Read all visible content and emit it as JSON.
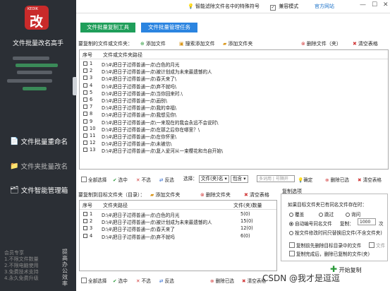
{
  "sidebar": {
    "logo_tag": "KEDIK",
    "logo_glyph": "改",
    "app_title": "文件批量改名高手",
    "nav": [
      {
        "label": "文件批量重命名"
      },
      {
        "label": "文件夹批量改名"
      },
      {
        "label": "文件智能管理箱"
      }
    ],
    "promo_lines": [
      "会员专享",
      "1.不限文件数量",
      "2.不限电脑使用",
      "3.免费技术支持",
      "4.永久免费升级"
    ],
    "promo_side": "提高办公效率"
  },
  "topbar": {
    "filter_label": "智能滤除文件名中的特殊符号",
    "compat_label": "兼容模式",
    "official_label": "官方网站",
    "min": "—",
    "max": "☐",
    "close": "✕"
  },
  "tabs": {
    "copy_tool": "文件批量复制工具",
    "manage": "文件批量管理任务"
  },
  "source": {
    "label": "要复制的文件或文件夹：",
    "add_file": "添加文件",
    "search_add": "搜索添加文件",
    "add_folder": "添加文件夹",
    "delete": "删除文件（夹）",
    "clear": "清空表格",
    "col_no": "序号",
    "col_path": "文件或文件夹路径",
    "rows": [
      {
        "n": "1",
        "p": "D:\\4\\把日子过得普通一点\\白色的月光"
      },
      {
        "n": "2",
        "p": "D:\\4\\把日子过得普通一点\\被计划成为未来最遗憾的人"
      },
      {
        "n": "3",
        "p": "D:\\4\\把日子过得普通一点\\春天来了\\"
      },
      {
        "n": "4",
        "p": "D:\\4\\把日子过得普通一点\\弃不就吗\\"
      },
      {
        "n": "5",
        "p": "D:\\4\\把日子过得普通一点\\当你回来时.\\"
      },
      {
        "n": "6",
        "p": "D:\\4\\把日子过得普通一点\\画别\\"
      },
      {
        "n": "7",
        "p": "D:\\4\\把日子过得普通一点\\我的幸福\\"
      },
      {
        "n": "8",
        "p": "D:\\4\\把日子过得普通一点\\我想见你\\"
      },
      {
        "n": "9",
        "p": "D:\\4\\把日子过得普通一点\\一来现在的我会永远不会说时\\"
      },
      {
        "n": "10",
        "p": "D:\\4\\把日子过得普通一点\\在那之后你在哪里？\\"
      },
      {
        "n": "11",
        "p": "D:\\4\\把日子过得普通一点\\在你怀里\\"
      },
      {
        "n": "12",
        "p": "D:\\4\\把日子过得普通一点\\未被信\\"
      },
      {
        "n": "13",
        "p": "D:\\4\\把日子过得普通一点\\复入爱河从一束樱花和鸟自开始\\"
      }
    ],
    "select_all": "全部选择",
    "select": "选中",
    "unselect": "不选",
    "invert": "反选",
    "select_by": "选择：",
    "file_name_opt": "文件(夹)名",
    "contains_opt": "包含",
    "placeholder": "多词用 | 号隔开",
    "confirm": "确定",
    "delete_selected": "删除已选",
    "clear2": "清空表格"
  },
  "target": {
    "label": "要复制到目标文件夹（目录）：",
    "add_folder": "添加文件夹",
    "delete": "删除文件夹",
    "clear": "清空表格",
    "col_no": "序号",
    "col_path": "文件夹路径",
    "col_count": "文件(夹)数量",
    "rows": [
      {
        "n": "1",
        "p": "D:\\4\\把日子过得普通一点\\白色的月光",
        "c": "5(0)"
      },
      {
        "n": "2",
        "p": "D:\\4\\把日子过得普通一点\\被计划成为未来最遗憾的人",
        "c": "15(0)"
      },
      {
        "n": "3",
        "p": "D:\\4\\把日子过得普通一点\\春天来了",
        "c": "12(0)"
      },
      {
        "n": "4",
        "p": "D:\\4\\把日子过得普通一点\\弃不就吗",
        "c": "6(0)"
      }
    ],
    "select_all": "全部选择",
    "select": "选中",
    "unselect": "不选",
    "invert": "反选",
    "delete_selected": "删除已选",
    "clear2": "清空表格"
  },
  "options": {
    "title": "复制选项",
    "question": "如果目标文件夹已有同名文件存在时：",
    "overwrite": "覆盖",
    "skip": "跳过",
    "ask": "询问",
    "auto_rename": "自动编号同名文件",
    "copies_label": "复制：",
    "copies_value": "1000",
    "copies_unit": "次",
    "by_time": "按文件修改时间只替换旧文件(不含文件夹)",
    "del_before": "复制前先删除目标目录中的文件",
    "file_label": "文件",
    "del_after": "复制完成后，删除已复制的文件(夹)",
    "start": "开始复制"
  },
  "watermark": "CSDN @我才是逗逗"
}
